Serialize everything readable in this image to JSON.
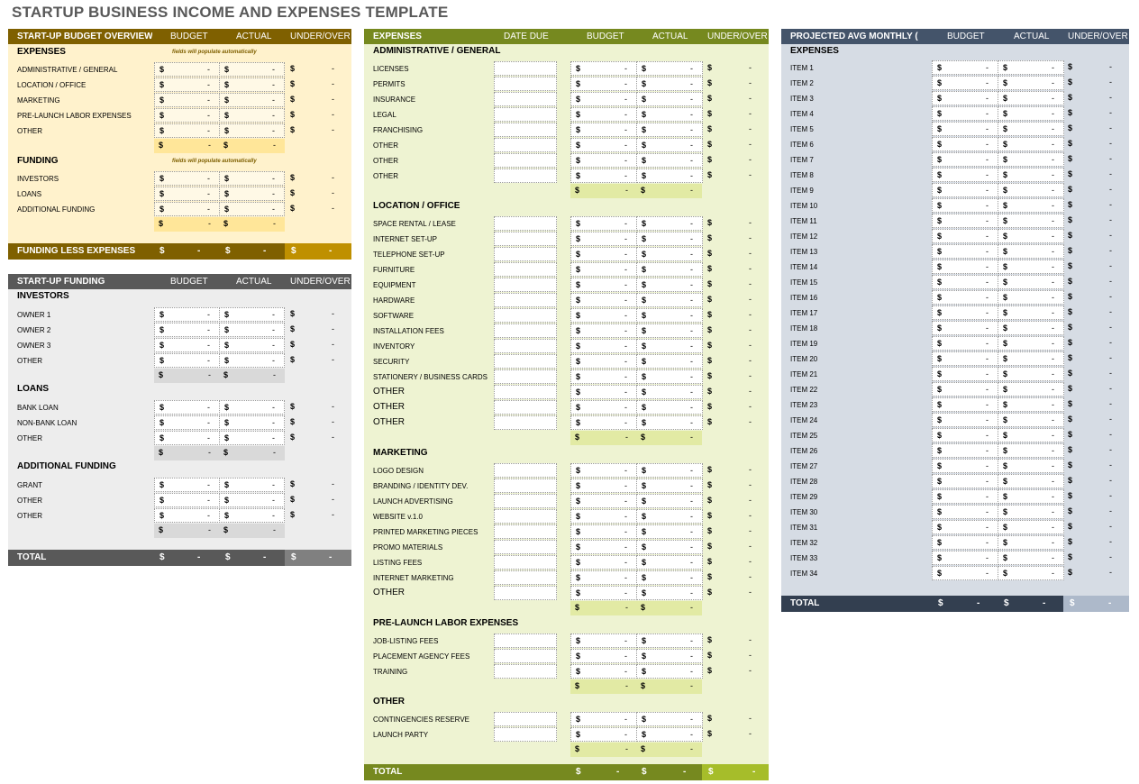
{
  "title": "STARTUP BUSINESS INCOME AND EXPENSES TEMPLATE",
  "currency_symbol": "$",
  "empty_value": "-",
  "colors": {
    "overview_header": "#7f6000",
    "overview_bg": "#fff2cc",
    "overview_subtotal": "#ffe699",
    "overview_accent": "#bf9000",
    "funding_header": "#595959",
    "funding_bg": "#ededed",
    "funding_subtotal": "#d9d9d9",
    "funding_accent": "#808080",
    "expenses_header": "#76891f",
    "expenses_bg": "#eef3d2",
    "expenses_subtotal": "#e2eaa4",
    "expenses_accent": "#a6bd2a",
    "monthly_header": "#44546a",
    "monthly_bg": "#d6dce4",
    "monthly_total": "#333f50",
    "monthly_accent": "#adb9ca"
  },
  "overview": {
    "header": {
      "title": "START-UP BUDGET OVERVIEW",
      "budget": "BUDGET",
      "actual": "ACTUAL",
      "under_over": "UNDER/OVER"
    },
    "note": "fields will populate automatically",
    "expenses_title": "EXPENSES",
    "expenses": [
      "ADMINISTRATIVE / GENERAL",
      "LOCATION / OFFICE",
      "MARKETING",
      "PRE-LAUNCH LABOR EXPENSES",
      "OTHER"
    ],
    "funding_title": "FUNDING",
    "funding": [
      "INVESTORS",
      "LOANS",
      "ADDITIONAL FUNDING"
    ],
    "funding_less_expenses": "FUNDING LESS EXPENSES"
  },
  "startup_funding": {
    "header": {
      "title": "START-UP FUNDING",
      "budget": "BUDGET",
      "actual": "ACTUAL",
      "under_over": "UNDER/OVER"
    },
    "groups": [
      {
        "title": "INVESTORS",
        "items": [
          "OWNER 1",
          "OWNER 2",
          "OWNER 3",
          "OTHER"
        ]
      },
      {
        "title": "LOANS",
        "items": [
          "BANK LOAN",
          "NON-BANK LOAN",
          "OTHER"
        ]
      },
      {
        "title": "ADDITIONAL FUNDING",
        "items": [
          "GRANT",
          "OTHER",
          "OTHER"
        ]
      }
    ],
    "total": "TOTAL"
  },
  "expenses": {
    "header": {
      "title": "EXPENSES",
      "date_due": "DATE DUE",
      "budget": "BUDGET",
      "actual": "ACTUAL",
      "under_over": "UNDER/OVER"
    },
    "groups": [
      {
        "title": "ADMINISTRATIVE / GENERAL",
        "items": [
          "LICENSES",
          "PERMITS",
          "INSURANCE",
          "LEGAL",
          "FRANCHISING",
          "OTHER",
          "OTHER",
          "OTHER"
        ]
      },
      {
        "title": "LOCATION / OFFICE",
        "items": [
          "SPACE RENTAL / LEASE",
          "INTERNET SET-UP",
          "TELEPHONE SET-UP",
          "FURNITURE",
          "EQUIPMENT",
          "HARDWARE",
          "SOFTWARE",
          "INSTALLATION FEES",
          "INVENTORY",
          "SECURITY",
          "STATIONERY / BUSINESS CARDS",
          "OTHER",
          "OTHER",
          "OTHER"
        ]
      },
      {
        "title": "MARKETING",
        "items": [
          "LOGO DESIGN",
          "BRANDING / IDENTITY DEV.",
          "LAUNCH ADVERTISING",
          "WEBSITE v.1.0",
          "PRINTED MARKETING PIECES",
          "PROMO MATERIALS",
          "LISTING FEES",
          "INTERNET MARKETING",
          "OTHER"
        ]
      },
      {
        "title": "PRE-LAUNCH LABOR EXPENSES",
        "items": [
          "JOB-LISTING FEES",
          "PLACEMENT AGENCY FEES",
          "TRAINING"
        ]
      },
      {
        "title": "OTHER",
        "items": [
          "CONTINGENCIES RESERVE",
          "LAUNCH PARTY"
        ]
      }
    ],
    "total": "TOTAL"
  },
  "monthly": {
    "header": {
      "title": "PROJECTED AVG MONTHLY (",
      "budget": "BUDGET",
      "actual": "ACTUAL",
      "under_over": "UNDER/OVER"
    },
    "expenses_title": "EXPENSES",
    "items": [
      "ITEM 1",
      "ITEM 2",
      "ITEM 3",
      "ITEM 4",
      "ITEM 5",
      "ITEM 6",
      "ITEM 7",
      "ITEM 8",
      "ITEM 9",
      "ITEM 10",
      "ITEM 11",
      "ITEM 12",
      "ITEM 13",
      "ITEM 14",
      "ITEM 15",
      "ITEM 16",
      "ITEM 17",
      "ITEM 18",
      "ITEM 19",
      "ITEM 20",
      "ITEM 21",
      "ITEM 22",
      "ITEM 23",
      "ITEM 24",
      "ITEM 25",
      "ITEM 26",
      "ITEM 27",
      "ITEM 28",
      "ITEM 29",
      "ITEM 30",
      "ITEM 31",
      "ITEM 32",
      "ITEM 33",
      "ITEM 34"
    ],
    "total": "TOTAL"
  }
}
